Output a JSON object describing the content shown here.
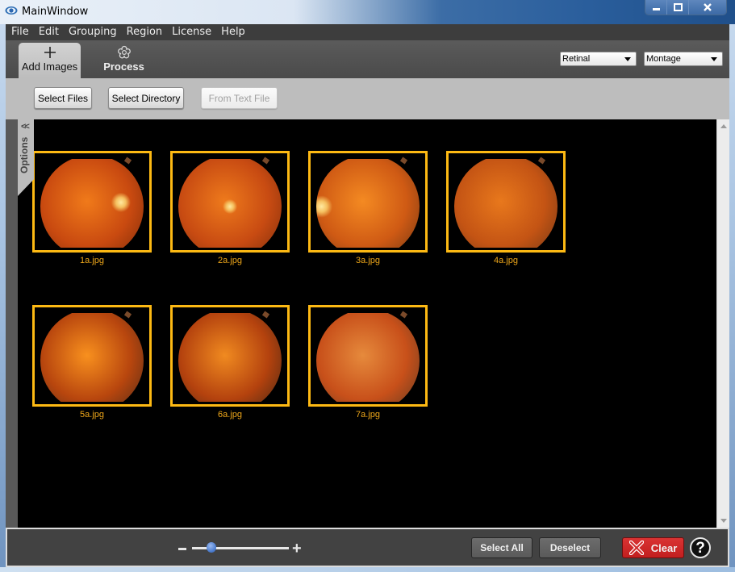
{
  "window": {
    "title": "MainWindow",
    "controls": [
      "minimize",
      "maximize",
      "close"
    ]
  },
  "menubar": {
    "items": [
      "File",
      "Edit",
      "Grouping",
      "Region",
      "License",
      "Help"
    ]
  },
  "toolbar": {
    "tabs": [
      {
        "label": "Add Images",
        "icon": "plus-icon",
        "active": true
      },
      {
        "label": "Process",
        "icon": "flower-gear-icon",
        "active": false
      }
    ],
    "region_select": {
      "value": "Retinal"
    },
    "mode_select": {
      "value": "Montage"
    }
  },
  "add_images": {
    "select_files_label": "Select Files",
    "select_directory_label": "Select Directory",
    "from_text_file_label": "From Text File",
    "from_text_file_enabled": false
  },
  "options_panel": {
    "label": "Options",
    "collapse_glyph": "<<"
  },
  "images": [
    {
      "name": "1a.jpg",
      "selected": true
    },
    {
      "name": "2a.jpg",
      "selected": true
    },
    {
      "name": "3a.jpg",
      "selected": true
    },
    {
      "name": "4a.jpg",
      "selected": true
    },
    {
      "name": "5a.jpg",
      "selected": true
    },
    {
      "name": "6a.jpg",
      "selected": true
    },
    {
      "name": "7a.jpg",
      "selected": true
    }
  ],
  "bottombar": {
    "zoom_minus": "-",
    "zoom_plus": "+",
    "zoom_level_fraction": 0.2,
    "select_all_label": "Select All",
    "deselect_label": "Deselect",
    "clear_label": "Clear",
    "help_label": "?"
  },
  "colors": {
    "selection_border": "#fdb913",
    "filename_text": "#f0a81a",
    "clear_button": "#c92424",
    "slider_thumb": "#4f7fd0"
  }
}
